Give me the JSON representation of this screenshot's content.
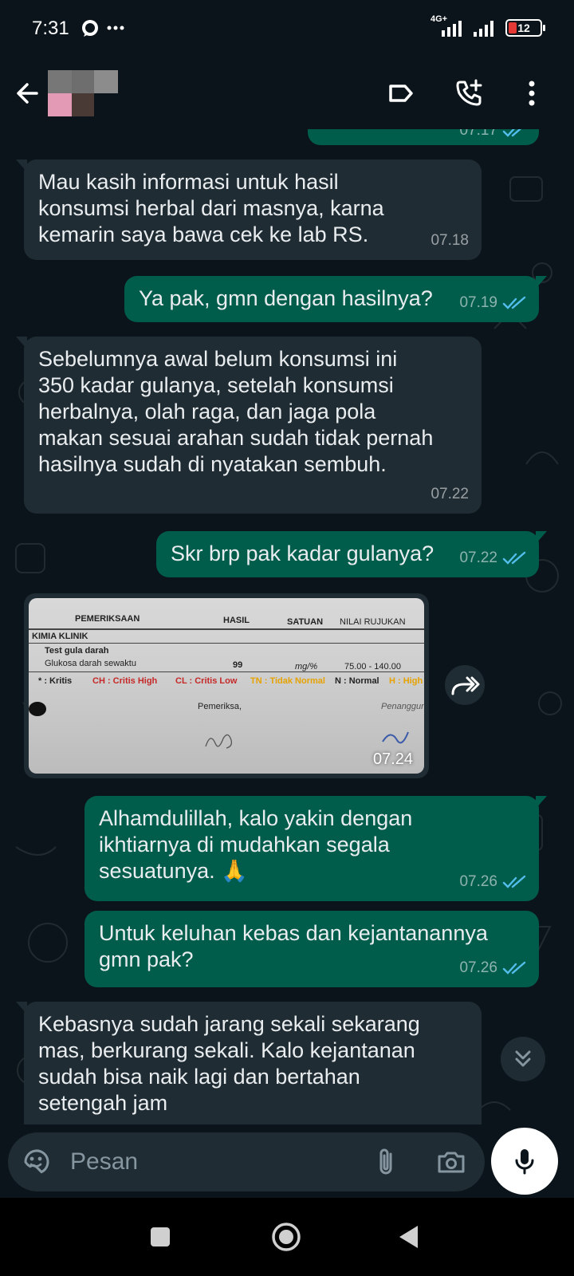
{
  "status_bar": {
    "time": "7:31",
    "network_label": "4G+",
    "battery": "12",
    "icons": [
      "whatsapp-status-icon",
      "more-dots-icon",
      "signal-icon",
      "battery-icon"
    ]
  },
  "app_bar": {
    "icons": [
      "back-arrow-icon",
      "label-icon",
      "add-call-icon",
      "more-vert-icon"
    ]
  },
  "messages": [
    {
      "id": "m0",
      "direction": "out",
      "text": "",
      "time": "07.17",
      "read": true
    },
    {
      "id": "m1",
      "direction": "in",
      "text": "Mau kasih informasi untuk hasil\nkonsumsi herbal dari masnya, karna\nkemarin saya bawa cek ke lab RS.",
      "time": "07.18"
    },
    {
      "id": "m2",
      "direction": "out",
      "text": "Ya pak, gmn dengan hasilnya?",
      "time": "07.19",
      "read": true
    },
    {
      "id": "m3",
      "direction": "in",
      "text": "Sebelumnya awal belum konsumsi ini\n350 kadar gulanya, setelah konsumsi\nherbalnya, olah raga, dan jaga pola\nmakan sesuai arahan sudah tidak pernah\nhasilnya sudah di nyatakan sembuh.",
      "time": "07.22"
    },
    {
      "id": "m4",
      "direction": "out",
      "text": "Skr brp pak kadar gulanya?",
      "time": "07.22",
      "read": true
    },
    {
      "id": "m5",
      "direction": "in",
      "type": "image",
      "time": "07.24"
    },
    {
      "id": "m6",
      "direction": "out",
      "text": "Alhamdulillah, kalo yakin dengan\nikhtiarnya di mudahkan segala\nsesuatunya. 🙏",
      "time": "07.26",
      "read": true
    },
    {
      "id": "m7",
      "direction": "out",
      "text": "Untuk keluhan kebas dan kejantanannya\ngmn pak?",
      "time": "07.26",
      "read": true
    },
    {
      "id": "m8",
      "direction": "in",
      "text": "Kebasnya sudah jarang sekali sekarang\nmas, berkurang sekali. Kalo kejantanan\nsudah bisa naik lagi dan bertahan\nsetengah jam",
      "time": ""
    }
  ],
  "lab_photo": {
    "header": {
      "pemeriksaan": "PEMERIKSAAN",
      "hasil": "HASIL",
      "satuan": "SATUAN",
      "nilai": "NILAI RUJUKAN"
    },
    "section": "KIMIA KLINIK",
    "test": "Test gula darah",
    "row": {
      "name": "Glukosa darah sewaktu",
      "value": "99",
      "unit": "mg/%",
      "range": "75.00 - 140.00"
    },
    "legend": [
      {
        "code": "* : Kritis",
        "color": "#222222"
      },
      {
        "code": "CH : Critis High",
        "color": "#c62828"
      },
      {
        "code": "CL : Critis Low",
        "color": "#c62828"
      },
      {
        "code": "TN : Tidak Normal",
        "color": "#e6a200"
      },
      {
        "code": "N : Normal",
        "color": "#222222"
      },
      {
        "code": "H : High",
        "color": "#e6a200"
      }
    ],
    "pemeriksa": "Pemeriksa,",
    "penanggung": "Penanggung"
  },
  "input": {
    "placeholder": "Pesan",
    "icons": [
      "sticker-icon",
      "attach-icon",
      "camera-icon",
      "mic-icon"
    ]
  },
  "nav": {
    "icons": [
      "recents-icon",
      "home-icon",
      "back-icon"
    ]
  },
  "colors": {
    "background": "#0b141a",
    "incoming_bubble": "#202c33",
    "outgoing_bubble": "#005c4b",
    "read_tick": "#53bdeb"
  }
}
